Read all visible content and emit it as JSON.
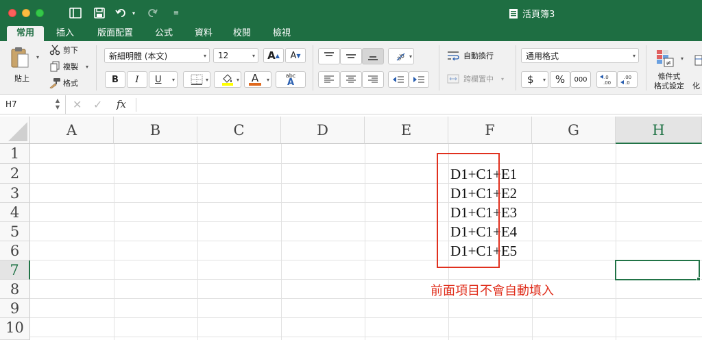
{
  "titlebar": {
    "title": "活頁簿3"
  },
  "tabs": [
    "常用",
    "插入",
    "版面配置",
    "公式",
    "資料",
    "校閱",
    "檢視"
  ],
  "ribbon": {
    "paste_label": "貼上",
    "cut_label": "剪下",
    "copy_label": "複製",
    "format_painter_label": "格式",
    "font_name": "新細明體 (本文)",
    "font_size": "12",
    "bold": "B",
    "italic": "I",
    "underline": "U",
    "wrap_text_label": "自動換行",
    "merge_center_label": "跨欄置中",
    "number_format": "通用格式",
    "currency_symbol": "$",
    "percent_symbol": "%",
    "comma_style": "000",
    "conditional_format_label_1": "條件式",
    "conditional_format_label_2": "格式設定",
    "format_as_table_partial": "化",
    "font_color_label": "A",
    "grow_font": "A",
    "shrink_font": "A",
    "phonetic_label": "abc"
  },
  "formula_bar": {
    "name_box": "H7",
    "fx_label": "fx",
    "formula": ""
  },
  "grid": {
    "columns": [
      "A",
      "B",
      "C",
      "D",
      "E",
      "F",
      "G",
      "H"
    ],
    "rows": [
      "1",
      "2",
      "3",
      "4",
      "5",
      "6",
      "7",
      "8",
      "9",
      "10"
    ],
    "selected_cell": "H7",
    "cells_f": [
      "D1+C1+E1",
      "D1+C1+E2",
      "D1+C1+E3",
      "D1+C1+E4",
      "D1+C1+E5"
    ],
    "annotation": "前面項目不會自動填入"
  },
  "colors": {
    "ribbon_green": "#1e6e42",
    "annotation_red": "#e0301e",
    "selection_green": "#217346"
  }
}
